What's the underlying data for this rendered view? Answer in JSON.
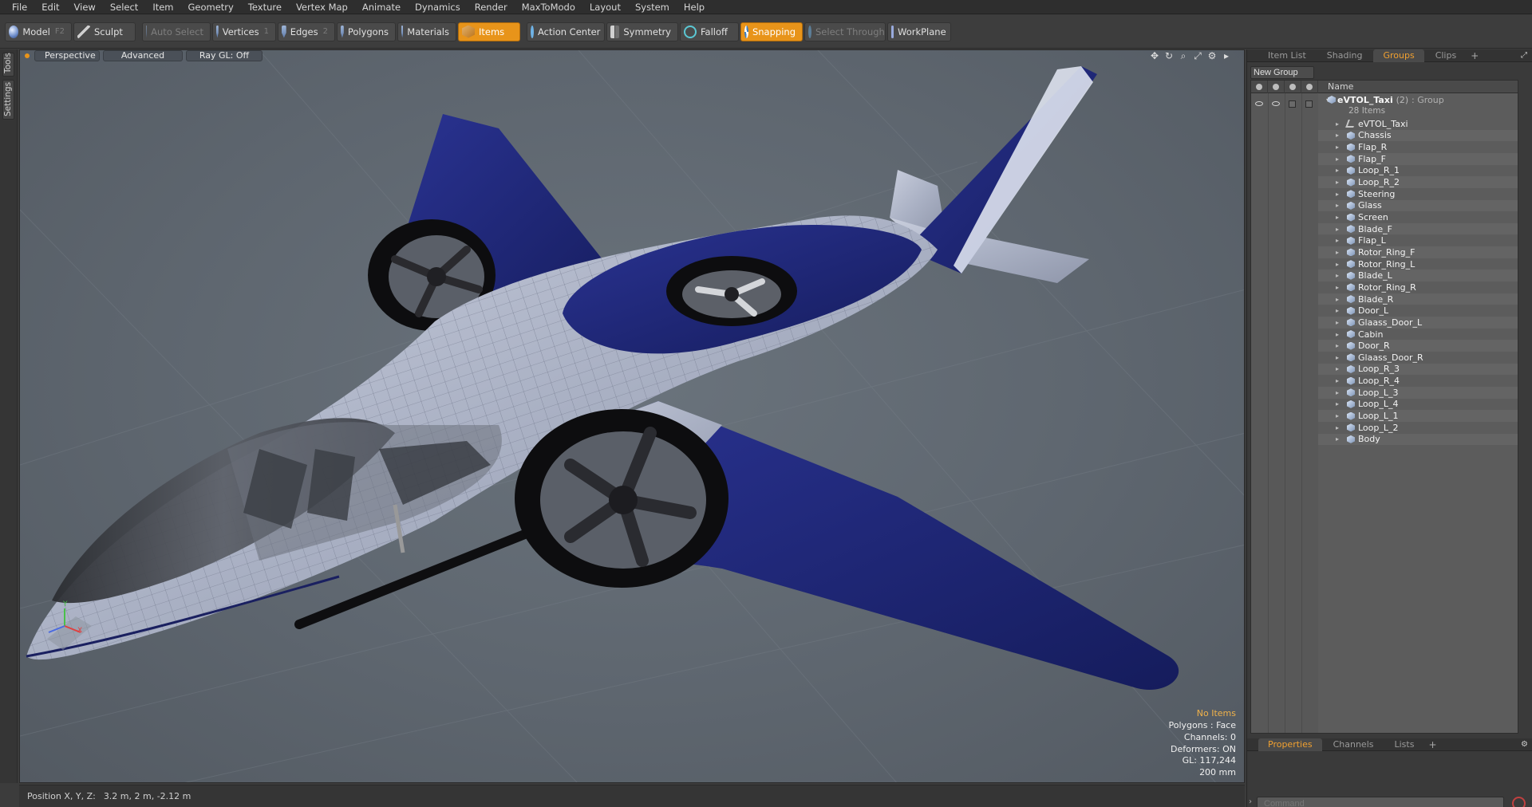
{
  "menu": [
    "File",
    "Edit",
    "View",
    "Select",
    "Item",
    "Geometry",
    "Texture",
    "Vertex Map",
    "Animate",
    "Dynamics",
    "Render",
    "MaxToModo",
    "Layout",
    "System",
    "Help"
  ],
  "toolbar": {
    "model": "Model",
    "model_key": "F2",
    "sculpt": "Sculpt",
    "auto_select": "Auto Select",
    "vertices": "Vertices",
    "vertices_key": "1",
    "edges": "Edges",
    "edges_key": "2",
    "polygons": "Polygons",
    "materials": "Materials",
    "items": "Items",
    "action_center": "Action Center",
    "symmetry": "Symmetry",
    "falloff": "Falloff",
    "snapping": "Snapping",
    "select_through": "Select Through",
    "workplane": "WorkPlane",
    "accent": "#e8941a"
  },
  "left_tabs": [
    "Tools",
    "Settings"
  ],
  "viewport": {
    "view": "Perspective",
    "advanced": "Advanced",
    "raygl": "Ray GL: Off",
    "info": {
      "selection": "No Items",
      "polygons": "Polygons : Face",
      "channels": "Channels: 0",
      "deformers": "Deformers: ON",
      "gl": "GL: 117,244",
      "scale": "200 mm"
    },
    "axis": {
      "y": "Y",
      "x": "X"
    }
  },
  "status": {
    "label": "Position X, Y, Z:",
    "value": "3.2 m, 2 m, -2.12 m"
  },
  "right_panel": {
    "tabs": [
      "Item List",
      "Shading",
      "Groups",
      "Clips"
    ],
    "active_tab": "Groups",
    "new_group": "New Group",
    "name_header": "Name",
    "group": {
      "name": "eVTOL_Taxi",
      "count": "(2)",
      "type": ": Group",
      "items_label": "28 Items"
    },
    "items": [
      "eVTOL_Taxi",
      "Chassis",
      "Flap_R",
      "Flap_F",
      "Loop_R_1",
      "Loop_R_2",
      "Steering",
      "Glass",
      "Screen",
      "Blade_F",
      "Flap_L",
      "Rotor_Ring_F",
      "Rotor_Ring_L",
      "Blade_L",
      "Rotor_Ring_R",
      "Blade_R",
      "Door_L",
      "Glaass_Door_L",
      "Cabin",
      "Door_R",
      "Glaass_Door_R",
      "Loop_R_3",
      "Loop_R_4",
      "Loop_L_3",
      "Loop_L_4",
      "Loop_L_1",
      "Loop_L_2",
      "Body"
    ],
    "bottom_tabs": [
      "Properties",
      "Channels",
      "Lists"
    ],
    "bottom_active": "Properties",
    "command_placeholder": "Command"
  }
}
